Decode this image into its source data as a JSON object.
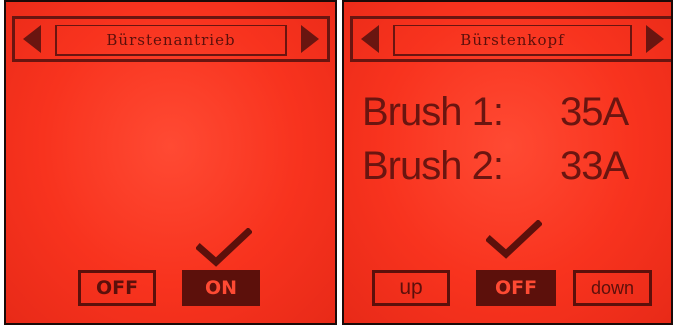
{
  "colors": {
    "background": "#f8331e",
    "foreground": "#5c100b"
  },
  "left_screen": {
    "title": "Bürstenantrieb",
    "buttons": {
      "off_label": "OFF",
      "on_label": "ON",
      "selected": "ON"
    },
    "icons": [
      "arrow-left-icon",
      "arrow-right-icon",
      "checkmark-icon"
    ]
  },
  "right_screen": {
    "title": "Bürstenkopf",
    "readings": [
      {
        "label": "Brush 1:",
        "value": "35A"
      },
      {
        "label": "Brush 2:",
        "value": "33A"
      }
    ],
    "buttons": {
      "up_label": "up",
      "off_label": "OFF",
      "down_label": "down",
      "selected": "OFF"
    },
    "icons": [
      "arrow-left-icon",
      "arrow-right-icon",
      "checkmark-icon"
    ]
  }
}
